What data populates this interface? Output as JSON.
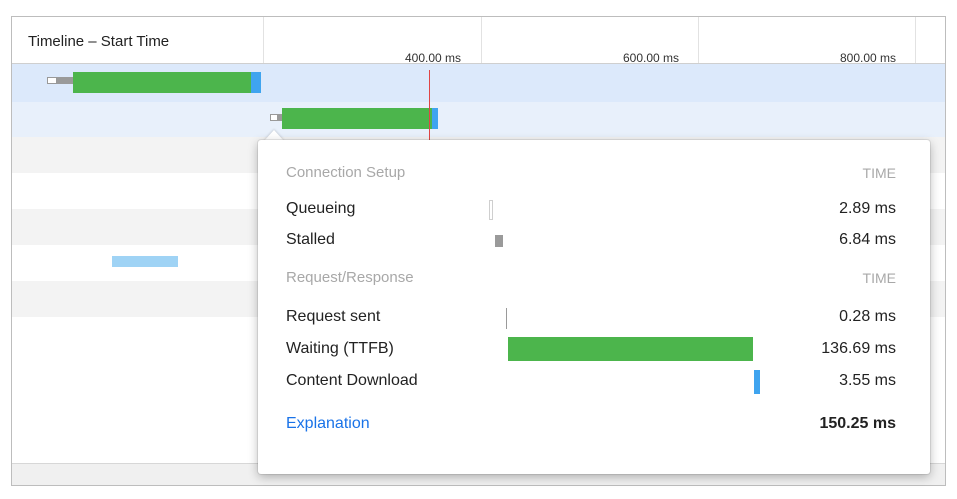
{
  "timeline": {
    "header_title": "Timeline – Start Time",
    "ticks": [
      "400.00 ms",
      "600.00 ms",
      "800.00 ms"
    ]
  },
  "popover": {
    "connection_section": "Connection Setup",
    "time_header_1": "TIME",
    "rows_connection": [
      {
        "label": "Queueing",
        "value": "2.89 ms"
      },
      {
        "label": "Stalled",
        "value": "6.84 ms"
      }
    ],
    "request_section": "Request/Response",
    "time_header_2": "TIME",
    "rows_request": [
      {
        "label": "Request sent",
        "value": "0.28 ms"
      },
      {
        "label": "Waiting (TTFB)",
        "value": "136.69 ms"
      },
      {
        "label": "Content Download",
        "value": "3.55 ms"
      }
    ],
    "explanation_link": "Explanation",
    "total": "150.25 ms"
  },
  "colors": {
    "waiting": "#4cb54c",
    "download": "#3fa4ef",
    "stalled": "#9a9a9a",
    "queueing": "#e6e6e6",
    "selected_row": "#dce9fb",
    "link": "#1a73e8"
  }
}
